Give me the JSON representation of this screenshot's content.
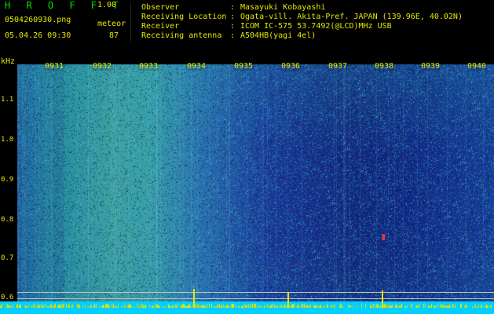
{
  "header": {
    "app_title": "H R O F F T",
    "app_version": "1.00",
    "filename": "0504260930.png",
    "detection_label": "meteor",
    "datetime": "05.04.26 09:30",
    "detection_count": "87",
    "info": [
      {
        "label": "Observer",
        "value": "Masayuki Kobayashi"
      },
      {
        "label": "Receiving Location",
        "value": "Ogata-vill. Akita-Pref. JAPAN (139.96E, 40.02N)"
      },
      {
        "label": "Receiver",
        "value": "ICOM IC-575 53.7492(@LCD)MHz USB"
      },
      {
        "label": "Receiving antenna",
        "value": "A504HB(yagi 4el)"
      }
    ]
  },
  "axis": {
    "unit": "kHz",
    "freq_ticks": [
      "1.1",
      "1.0",
      "0.9",
      "0.8",
      "0.7",
      "0.6"
    ],
    "time_labels": [
      "0931",
      "0932",
      "0933",
      "0934",
      "0935",
      "0936",
      "0937",
      "0938",
      "0939",
      "0940"
    ]
  },
  "colors": {
    "text": "#e6e600",
    "title": "#00e000",
    "baseband": "#00cfff",
    "meteor_mark": "#ff3030"
  }
}
